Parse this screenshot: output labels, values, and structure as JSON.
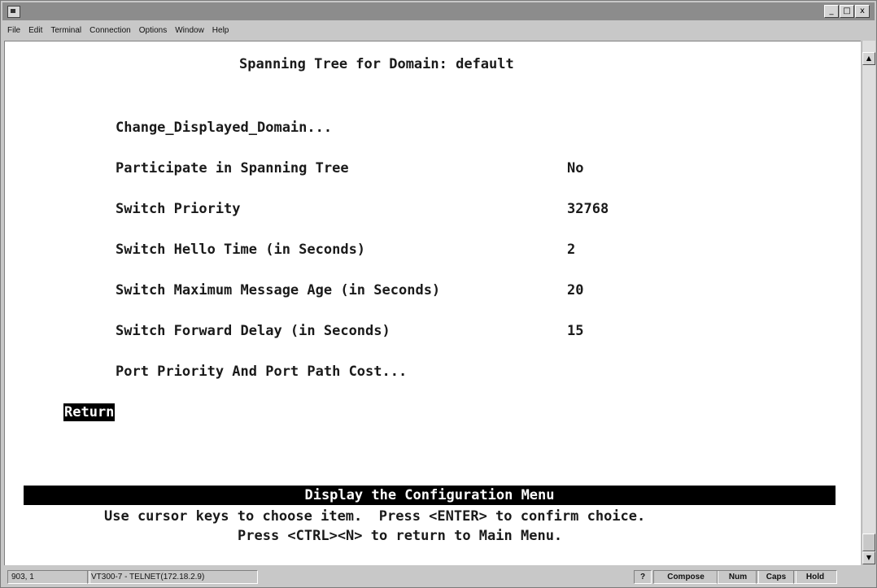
{
  "window": {
    "buttons": {
      "minimize": "_",
      "maximize": "□",
      "close": "x"
    }
  },
  "menubar": {
    "items": [
      "File",
      "Edit",
      "Terminal",
      "Connection",
      "Options",
      "Window",
      "Help"
    ]
  },
  "screen": {
    "title": "Spanning Tree for Domain: default",
    "items": [
      {
        "label": "Change_Displayed_Domain...",
        "value": ""
      },
      {
        "label": "Participate in Spanning Tree",
        "value": "No"
      },
      {
        "label": "Switch Priority",
        "value": "32768"
      },
      {
        "label": "Switch Hello Time (in Seconds)",
        "value": "2"
      },
      {
        "label": "Switch Maximum Message Age (in Seconds)",
        "value": "20"
      },
      {
        "label": "Switch Forward Delay (in Seconds)",
        "value": "15"
      },
      {
        "label": "Port Priority And Port Path Cost...",
        "value": ""
      }
    ],
    "return_label": "Return",
    "status_message": "Display the Configuration Menu",
    "help_line_1": "Use cursor keys to choose item.  Press <ENTER> to confirm choice.",
    "help_line_2": "Press <CTRL><N> to return to Main Menu."
  },
  "statusbar": {
    "cursor_position": "903, 1",
    "connection": "VT300-7 - TELNET(172.18.2.9)",
    "help": "?",
    "compose": "Compose",
    "num": "Num",
    "caps": "Caps",
    "hold": "Hold"
  }
}
